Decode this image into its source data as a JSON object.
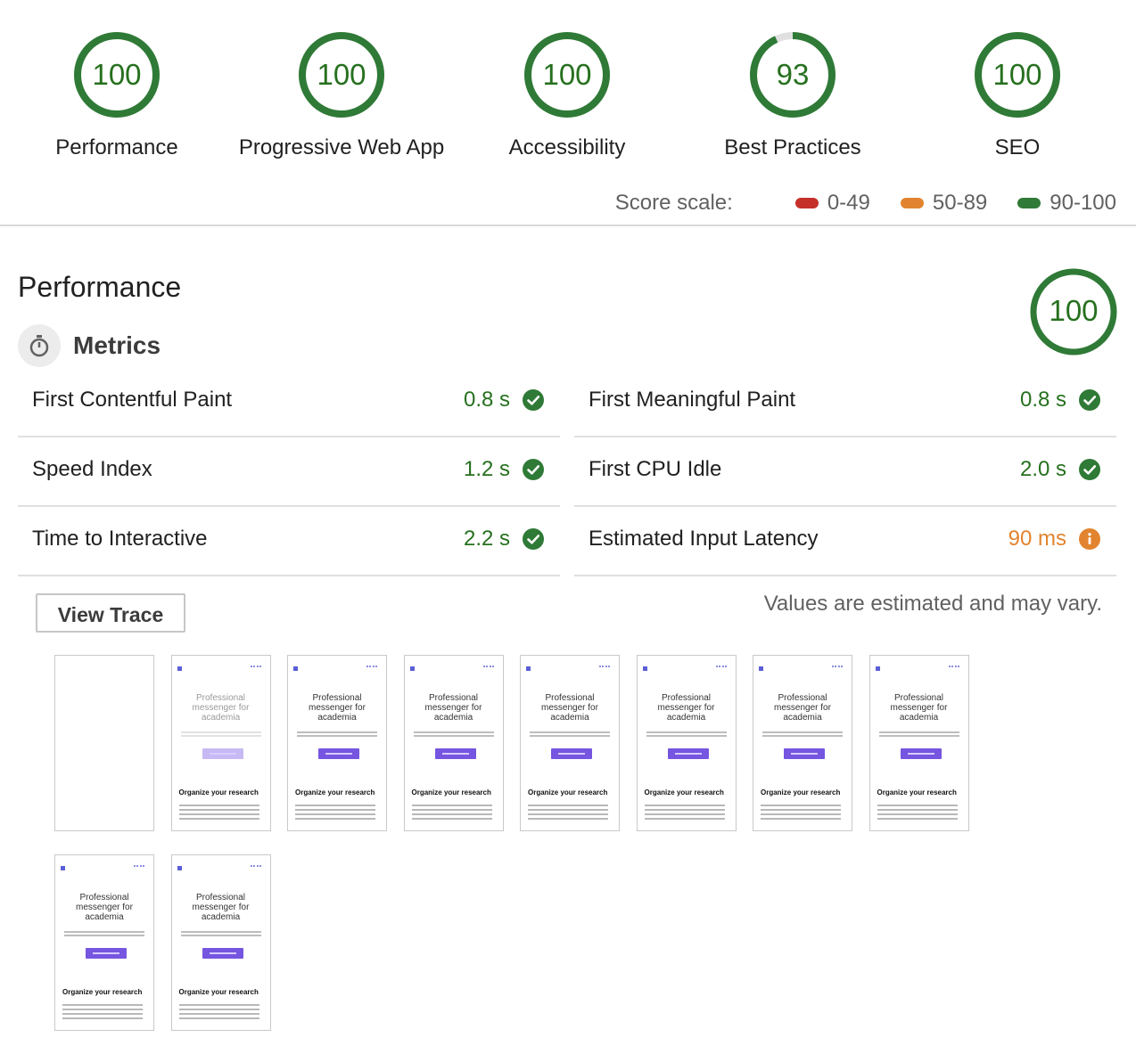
{
  "categories": [
    {
      "label": "Performance",
      "score": "100",
      "value": 100
    },
    {
      "label": "Progressive Web App",
      "score": "100",
      "value": 100
    },
    {
      "label": "Accessibility",
      "score": "100",
      "value": 100
    },
    {
      "label": "Best Practices",
      "score": "93",
      "value": 93
    },
    {
      "label": "SEO",
      "score": "100",
      "value": 100
    }
  ],
  "scale": {
    "title": "Score scale:",
    "ranges": [
      {
        "label": "0-49",
        "color": "#c5302b"
      },
      {
        "label": "50-89",
        "color": "#e2842f"
      },
      {
        "label": "90-100",
        "color": "#2f7a36"
      }
    ]
  },
  "colors": {
    "pass": "#2f7a36",
    "pass_text": "#26701e",
    "average": "#e2842f",
    "fail": "#c5302b"
  },
  "performance": {
    "title": "Performance",
    "score": "100",
    "metrics_heading": "Metrics",
    "metrics_icon": "stopwatch-icon",
    "metrics": [
      {
        "name": "First Contentful Paint",
        "value": "0.8 s",
        "status": "pass"
      },
      {
        "name": "First Meaningful Paint",
        "value": "0.8 s",
        "status": "pass"
      },
      {
        "name": "Speed Index",
        "value": "1.2 s",
        "status": "pass"
      },
      {
        "name": "First CPU Idle",
        "value": "2.0 s",
        "status": "pass"
      },
      {
        "name": "Time to Interactive",
        "value": "2.2 s",
        "status": "pass"
      },
      {
        "name": "Estimated Input Latency",
        "value": "90 ms",
        "status": "average"
      }
    ],
    "view_trace_label": "View Trace",
    "estimate_note": "Values are estimated and may vary.",
    "filmstrip": {
      "frame_heading": [
        "Professional",
        "messenger for",
        "academia"
      ],
      "frame_subheading": "Organize your research",
      "frames": [
        "blank",
        "partial",
        "complete",
        "complete",
        "complete",
        "complete",
        "complete",
        "complete",
        "complete",
        "complete"
      ]
    }
  }
}
